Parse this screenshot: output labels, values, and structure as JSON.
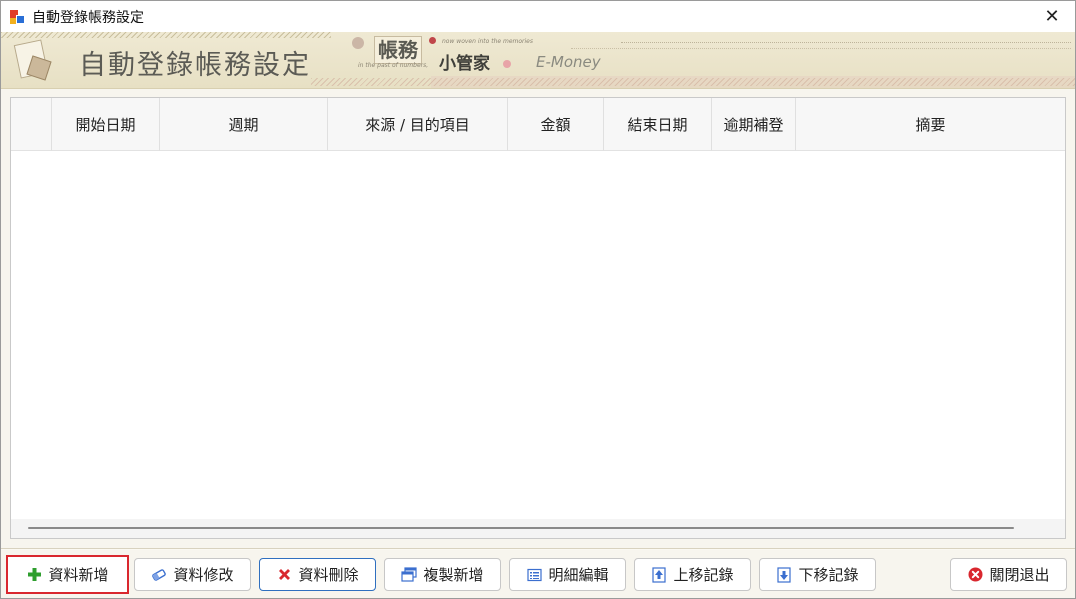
{
  "window": {
    "title": "自動登錄帳務設定",
    "close_glyph": "✕"
  },
  "banner": {
    "title": "自動登錄帳務設定",
    "logo_main": "帳務",
    "logo_sub": "小管家",
    "tagline_top": "now woven into the memories",
    "tagline_bottom": "in the past of numbers,",
    "brand": "E-Money"
  },
  "grid": {
    "columns": [
      {
        "label": ""
      },
      {
        "label": "開始日期"
      },
      {
        "label": "週期"
      },
      {
        "label": "來源 / 目的項目"
      },
      {
        "label": "金額"
      },
      {
        "label": "結束日期"
      },
      {
        "label": "逾期補登"
      },
      {
        "label": "摘要"
      }
    ],
    "rows": []
  },
  "buttons": {
    "add": {
      "label": "資料新增",
      "icon": "plus-icon",
      "color": "#2e9e2e"
    },
    "edit": {
      "label": "資料修改",
      "icon": "eraser-icon",
      "color": "#3b6fcf"
    },
    "delete": {
      "label": "資料刪除",
      "icon": "delete-x-icon",
      "color": "#d9272e"
    },
    "copy_add": {
      "label": "複製新增",
      "icon": "copy-window-icon",
      "color": "#3b6fcf"
    },
    "detail_edit": {
      "label": "明細編輯",
      "icon": "detail-list-icon",
      "color": "#3b6fcf"
    },
    "move_up": {
      "label": "上移記錄",
      "icon": "move-up-icon",
      "color": "#3b6fcf"
    },
    "move_down": {
      "label": "下移記錄",
      "icon": "move-down-icon",
      "color": "#3b6fcf"
    },
    "exit": {
      "label": "關閉退出",
      "icon": "close-circle-icon",
      "color": "#d9272e"
    }
  }
}
